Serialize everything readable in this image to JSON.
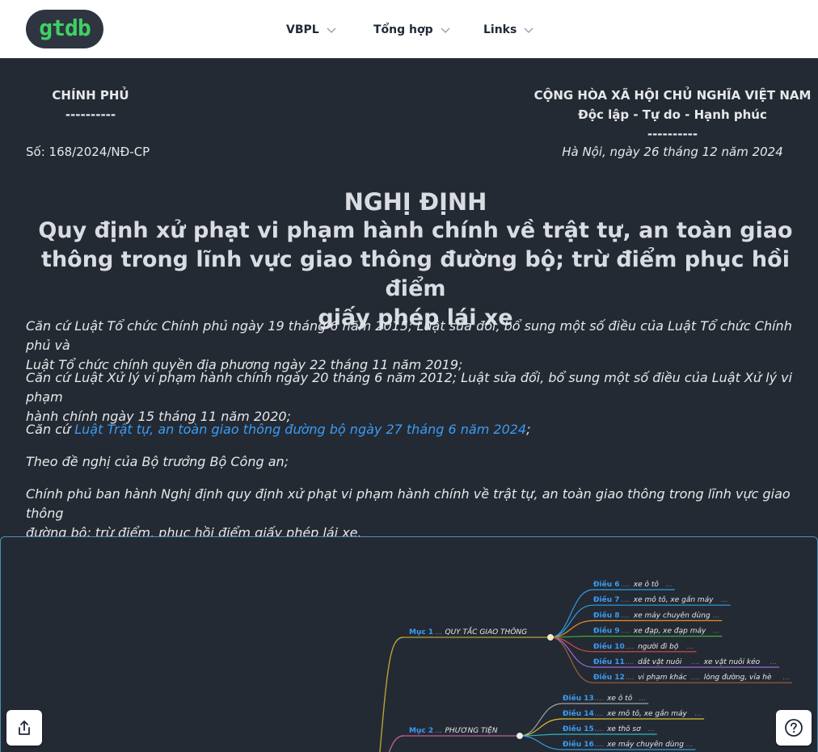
{
  "nav": {
    "logo": "gtdb",
    "items": [
      "VBPL",
      "Tổng hợp",
      "Links"
    ]
  },
  "header": {
    "left_title": "CHÍNH PHỦ",
    "left_rule": "----------",
    "right_title": "CỘNG HÒA XÃ HỘI CHỦ NGHĨA VIỆT NAM",
    "right_motto": "Độc lập - Tự do - Hạnh phúc",
    "right_rule": "----------",
    "number": "Số: 168/2024/NĐ-CP",
    "date": "Hà Nội, ngày 26 tháng 12 năm 2024"
  },
  "title": {
    "kind": "NGHỊ ĐỊNH",
    "line1": "Quy định xử phạt vi phạm hành chính về trật tự, an toàn giao",
    "line2": "thông trong lĩnh vực giao thông đường bộ; trừ điểm phục hồi điểm",
    "line3": "giấy phép lái xe"
  },
  "preamble": {
    "p1_line1": "Căn cứ Luật Tổ chức Chính phủ ngày 19 tháng 6 năm 2015; Luật sửa đổi, bổ sung một số điều của Luật Tổ chức Chính phủ và",
    "p1_line2": "Luật Tổ chức chính quyền địa phương ngày 22 tháng 11 năm 2019;",
    "p2_line1": "Căn cứ Luật Xử lý vi phạm hành chính ngày 20 tháng 6 năm 2012; Luật sửa đổi, bổ sung một số điều của Luật Xử lý vi phạm",
    "p2_line2": "hành chính ngày 15 tháng 11 năm 2020;",
    "p3_prefix": "Căn cứ ",
    "p3_link": "Luật Trật tự, an toàn giao thông đường bộ ngày 27 tháng 6 năm 2024",
    "p3_suffix": ";",
    "p4": "Theo đề nghị của Bộ trưởng Bộ Công an;",
    "p5_line1": "Chính phủ ban hành Nghị định quy định xử phạt vi phạm hành chính về trật tự, an toàn giao thông trong lĩnh vực giao thông",
    "p5_line2": "đường bộ; trừ điểm, phục hồi điểm giấy phép lái xe."
  },
  "mindmap": {
    "sections": [
      {
        "label": "Mục 1",
        "title": "QUY TẮC GIAO THÔNG",
        "items": [
          {
            "label": "Điều 6",
            "text": "xe ô tô",
            "color": "#2f9fe0"
          },
          {
            "label": "Điều 7",
            "text": "xe mô tô, xe gắn máy",
            "color": "#2f9fe0"
          },
          {
            "label": "Điều 8",
            "text": "xe máy chuyên dùng",
            "color": "#e88a2b"
          },
          {
            "label": "Điều 9",
            "text": "xe đạp, xe đạp máy",
            "color": "#3cae3c"
          },
          {
            "label": "Điều 10",
            "text": "người đi bộ",
            "color": "#d84a4a"
          },
          {
            "label": "Điều 11",
            "text": "dắt vật nuôi",
            "text2": "xe vật nuôi kéo",
            "color": "#9b6ad4"
          },
          {
            "label": "Điều 12",
            "text": "vi phạm khác",
            "text2": "lòng đường, vỉa hè",
            "color": "#a0603a"
          }
        ]
      },
      {
        "label": "Mục 2",
        "title": "PHƯƠNG TIỆN",
        "items": [
          {
            "label": "Điều 13",
            "text": "xe ô tô",
            "color": "#a0a3a8"
          },
          {
            "label": "Điều 14",
            "text": "xe mô tô, xe gắn máy",
            "color": "#d8c23a"
          },
          {
            "label": "Điều 15",
            "text": "xe thô sơ",
            "color": "#2fb6c4"
          },
          {
            "label": "Điều 16",
            "text": "xe máy chuyên dùng",
            "color": "#2f9fe0"
          }
        ]
      }
    ]
  },
  "buttons": {
    "share_icon": "share-icon",
    "help_icon": "help-icon"
  }
}
